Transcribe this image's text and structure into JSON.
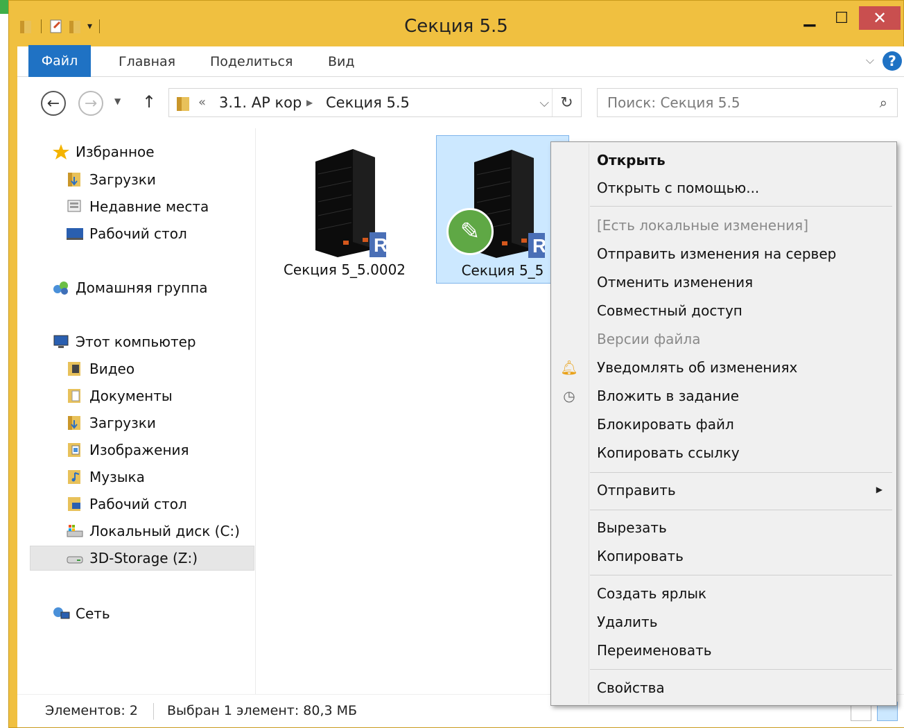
{
  "window": {
    "title": "Секция 5.5"
  },
  "ribbon": {
    "file": "Файл",
    "home": "Главная",
    "share": "Поделиться",
    "view": "Вид"
  },
  "address": {
    "chevron": "«",
    "segment1": "3.1. АР кор",
    "segment2": "Секция 5.5"
  },
  "search": {
    "placeholder": "Поиск: Секция 5.5"
  },
  "nav": {
    "favorites": "Избранное",
    "downloads": "Загрузки",
    "recent": "Недавние места",
    "desktop": "Рабочий стол",
    "homegroup": "Домашняя группа",
    "this_pc": "Этот компьютер",
    "video": "Видео",
    "documents": "Документы",
    "downloads2": "Загрузки",
    "images": "Изображения",
    "music": "Музыка",
    "desktop2": "Рабочий стол",
    "local_disk": "Локальный диск (C:)",
    "storage": "3D-Storage (Z:)",
    "network": "Сеть"
  },
  "files": [
    {
      "name": "Секция 5_5.0002"
    },
    {
      "name": "Секция 5_5"
    }
  ],
  "context_menu": {
    "open": "Открыть",
    "open_with": "Открыть с помощью...",
    "local_changes": "[Есть локальные изменения]",
    "send_changes": "Отправить изменения на сервер",
    "cancel_changes": "Отменить изменения",
    "shared_access": "Совместный доступ",
    "file_versions": "Версии файла",
    "notify_changes": "Уведомлять об изменениях",
    "attach_to_task": "Вложить в задание",
    "lock_file": "Блокировать файл",
    "copy_link": "Копировать ссылку",
    "send_to": "Отправить",
    "cut": "Вырезать",
    "copy": "Копировать",
    "create_shortcut": "Создать ярлык",
    "delete": "Удалить",
    "rename": "Переименовать",
    "properties": "Свойства"
  },
  "status": {
    "count": "Элементов: 2",
    "selected": "Выбран 1 элемент: 80,3 МБ"
  },
  "colors": {
    "frame": "#f0c040",
    "accent": "#1f72c4",
    "close": "#c94f4f",
    "selection": "#cce8ff",
    "badge": "#5fa845"
  },
  "icons": [
    "folder-icon",
    "star-icon",
    "search-icon",
    "refresh-icon",
    "bell-icon",
    "clock-icon",
    "pencil-icon",
    "revit-icon"
  ]
}
